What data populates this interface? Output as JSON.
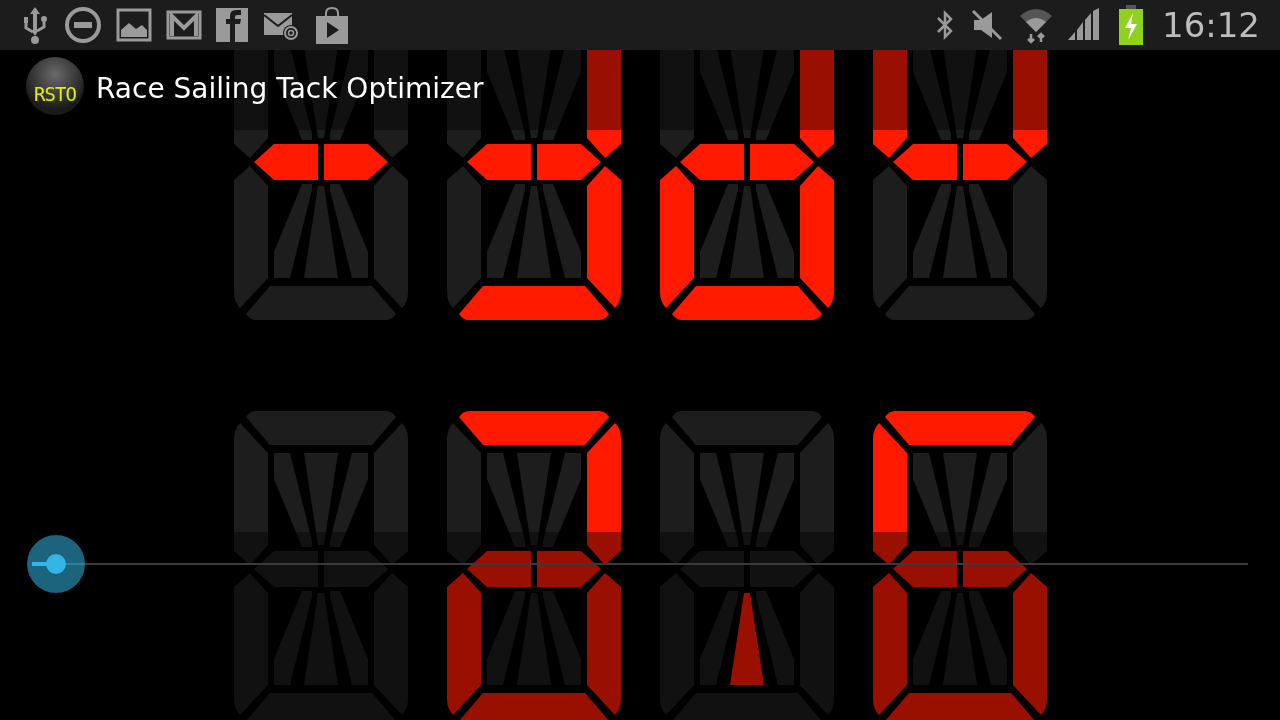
{
  "status_bar": {
    "time": "16:12"
  },
  "action_bar": {
    "logo_text": "RSTO",
    "title": "Race Sailing Tack Optimizer"
  },
  "rows": [
    {
      "digits": [
        {
          "segments": {
            "b": false,
            "c": false,
            "d": false,
            "e": false,
            "f": false,
            "g1": true,
            "g2": true,
            "h": false,
            "i": false,
            "j": false,
            "k": false,
            "l": false,
            "m": false
          }
        },
        {
          "segments": {
            "b": true,
            "c": true,
            "d": true,
            "e": false,
            "f": false,
            "g1": true,
            "g2": true,
            "h": false,
            "i": false,
            "j": false,
            "k": false,
            "l": false,
            "m": false
          }
        },
        {
          "segments": {
            "b": true,
            "c": true,
            "d": true,
            "e": true,
            "f": false,
            "g1": true,
            "g2": true,
            "h": false,
            "i": false,
            "j": false,
            "k": false,
            "l": false,
            "m": false
          }
        },
        {
          "segments": {
            "b": true,
            "c": false,
            "d": false,
            "e": false,
            "f": true,
            "g1": true,
            "g2": true,
            "h": false,
            "i": false,
            "j": false,
            "k": false,
            "l": false,
            "m": false
          }
        }
      ]
    },
    {
      "digits": [
        {
          "segments": {
            "a": false,
            "b": false,
            "c": false,
            "d": false,
            "e": false,
            "f": false,
            "g1": false,
            "g2": false,
            "h": false,
            "i": false,
            "j": false,
            "k": false,
            "l": false,
            "m": false
          }
        },
        {
          "segments": {
            "a": true,
            "b": true,
            "c": true,
            "d": true,
            "e": true,
            "f": false,
            "g1": true,
            "g2": true,
            "h": false,
            "i": false,
            "j": false,
            "k": false,
            "l": false,
            "m": false
          }
        },
        {
          "segments": {
            "a": false,
            "b": false,
            "c": false,
            "d": false,
            "e": false,
            "f": false,
            "g1": false,
            "g2": false,
            "h": false,
            "i": false,
            "j": false,
            "k": false,
            "l": true,
            "m": false
          }
        },
        {
          "segments": {
            "a": true,
            "b": false,
            "c": true,
            "d": true,
            "e": true,
            "f": true,
            "g1": true,
            "g2": true,
            "h": false,
            "i": false,
            "j": false,
            "k": false,
            "l": false,
            "m": false
          }
        }
      ]
    }
  ],
  "seekbar": {
    "level": 0.02
  }
}
